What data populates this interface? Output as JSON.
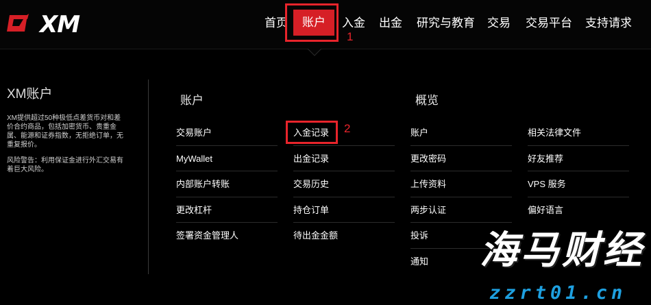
{
  "brand": {
    "logo_text": "XM",
    "accent": "#d61f26"
  },
  "nav": {
    "items": [
      "首页",
      "账户",
      "入金",
      "出金",
      "研究与教育",
      "交易",
      "交易平台",
      "支持请求"
    ],
    "active": "账户"
  },
  "annotations": {
    "step1": "1",
    "step2": "2",
    "color": "#e8242b"
  },
  "left_panel": {
    "title": "XM账户",
    "description": "XM提供超过50种极低点差货币对和差价合约商品，包括加密货币、贵重金属、能源和证券指数，无拒绝订单，无重复报价。",
    "warning": "风险警告：利用保证金进行外汇交易有着巨大风险。"
  },
  "sections": {
    "account": {
      "title": "账户",
      "col1": [
        "交易账户",
        "MyWallet",
        "内部账户转账",
        "更改杠杆",
        "签署资金管理人"
      ],
      "col2": [
        "入金记录",
        "出金记录",
        "交易历史",
        "持仓订单",
        "待出金金额"
      ]
    },
    "overview": {
      "title": "概览",
      "col1": [
        "账户",
        "更改密码",
        "上传资料",
        "两步认证",
        "投诉",
        "通知"
      ],
      "col2": [
        "相关法律文件",
        "好友推荐",
        "VPS 服务",
        "偏好语言"
      ]
    }
  },
  "watermark": {
    "brand_cn": "海马财经",
    "url": "zzrt01.cn",
    "url_color": "#1ea0e0"
  }
}
